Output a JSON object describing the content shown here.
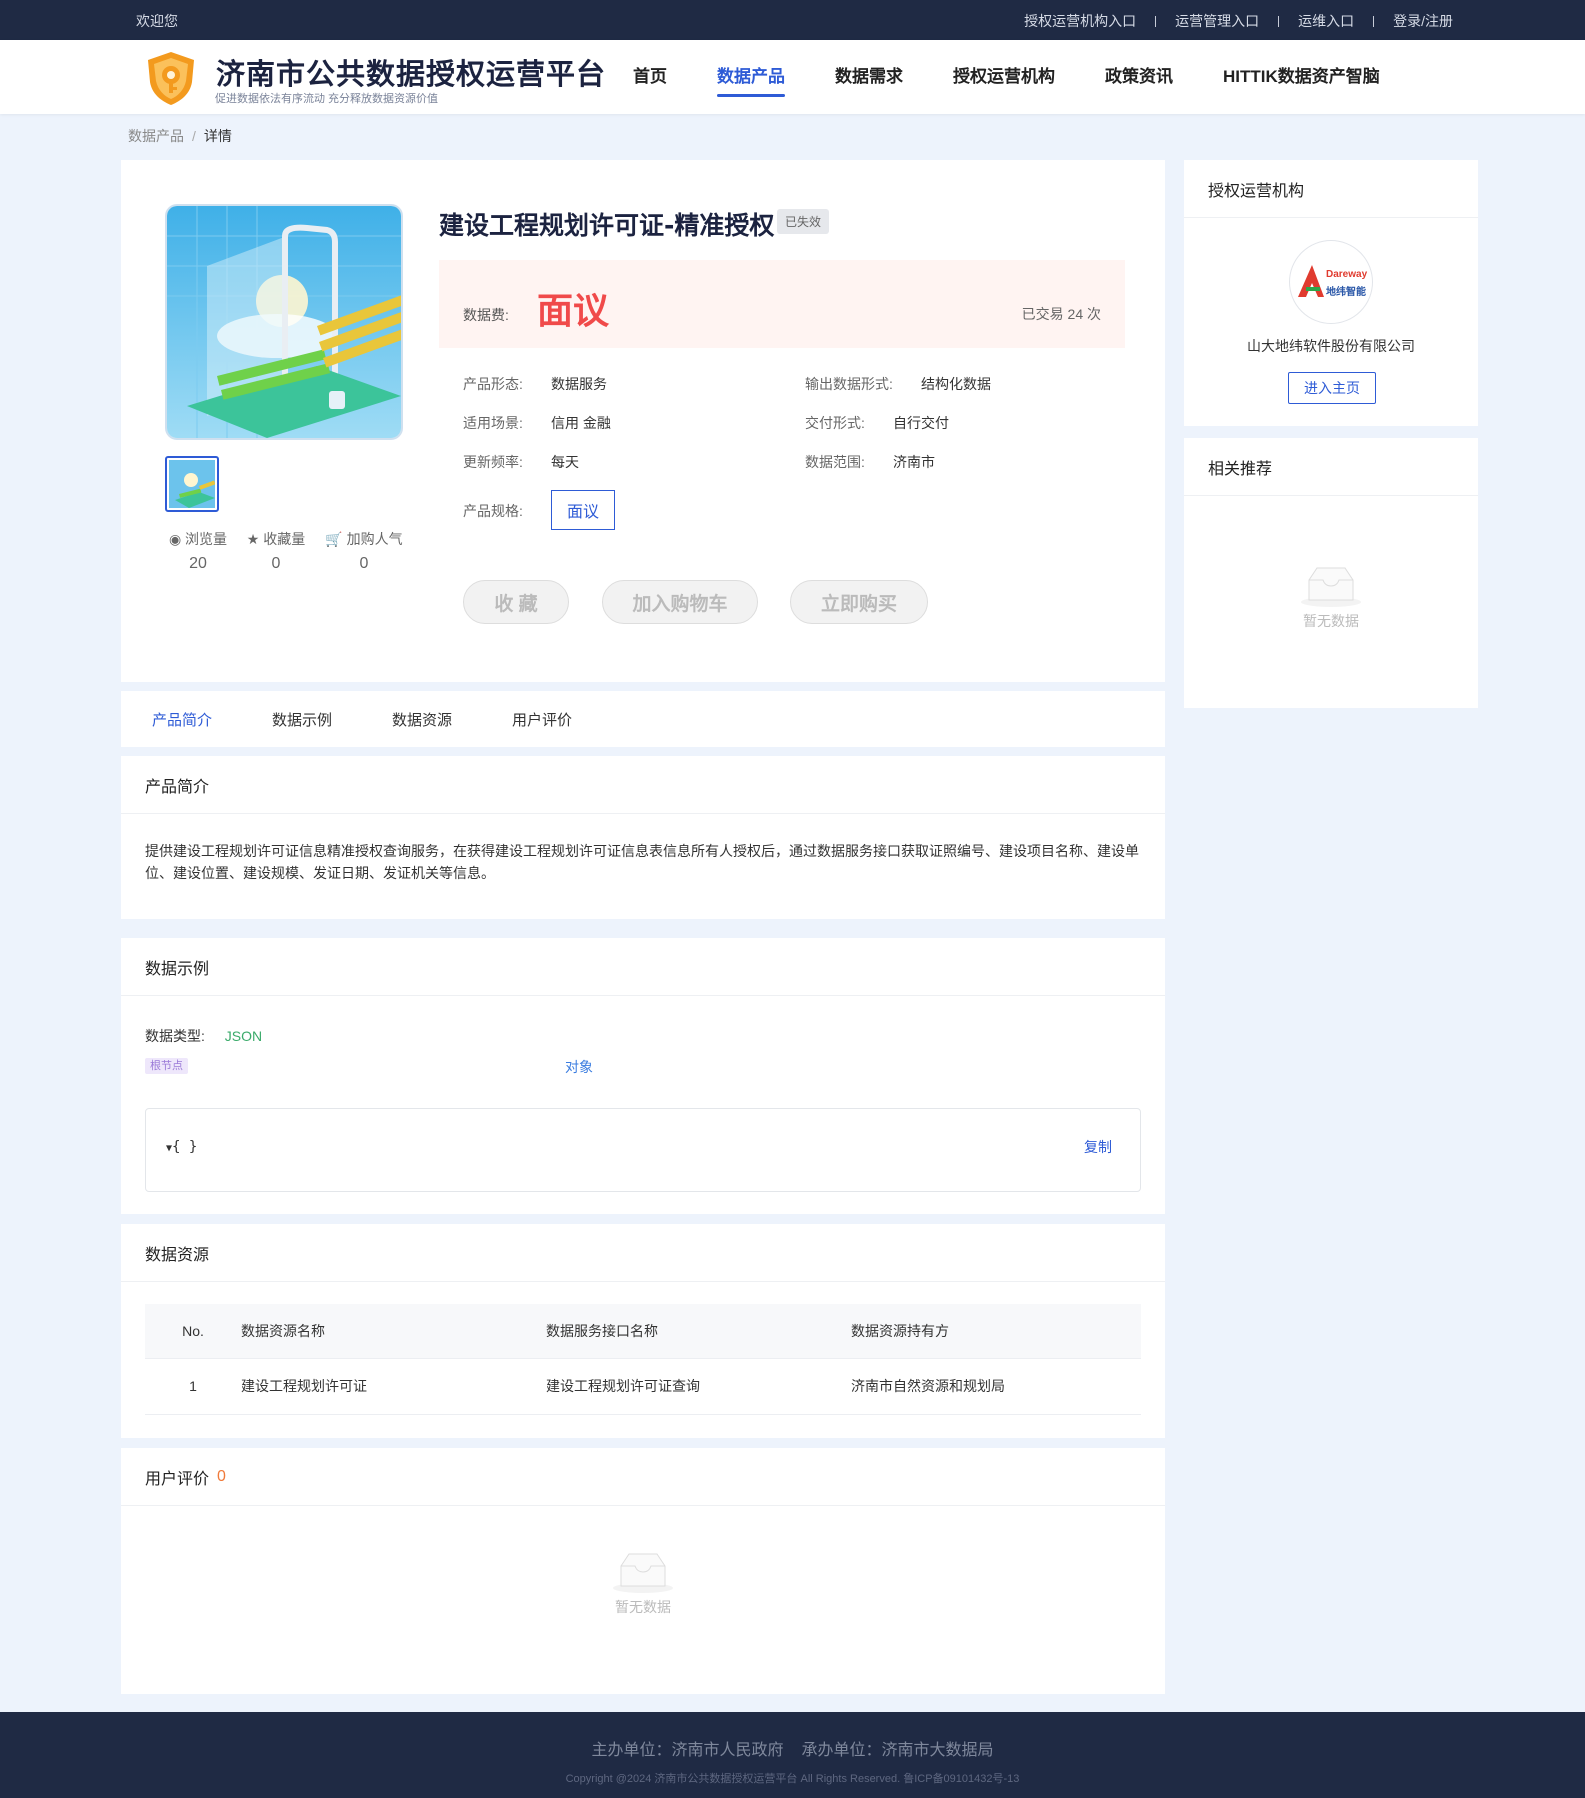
{
  "topbar": {
    "welcome": "欢迎您",
    "links": [
      "授权运营机构入口",
      "运营管理入口",
      "运维入口",
      "登录/注册"
    ]
  },
  "header": {
    "title": "济南市公共数据授权运营平台",
    "subtitle": "促进数据依法有序流动 充分释放数据资源价值",
    "nav": [
      "首页",
      "数据产品",
      "数据需求",
      "授权运营机构",
      "政策资讯",
      "HITTIK数据资产智脑"
    ],
    "active_nav": "数据产品"
  },
  "breadcrumb": {
    "parent": "数据产品",
    "sep": "/",
    "current": "详情"
  },
  "product": {
    "title": "建设工程规划许可证-精准授权",
    "status": "已失效",
    "price_label": "数据费:",
    "price": "面议",
    "traded": "已交易 24 次",
    "attrs": {
      "form_k": "产品形态:",
      "form_v": "数据服务",
      "output_k": "输出数据形式:",
      "output_v": "结构化数据",
      "scene_k": "适用场景:",
      "scene_v": "信用 金融",
      "delivery_k": "交付形式:",
      "delivery_v": "自行交付",
      "freq_k": "更新频率:",
      "freq_v": "每天",
      "range_k": "数据范围:",
      "range_v": "济南市",
      "spec_k": "产品规格:",
      "spec_v": "面议"
    },
    "stats": {
      "views_label": "浏览量",
      "views": "20",
      "fav_label": "收藏量",
      "fav": "0",
      "cart_label": "加购人气",
      "cart": "0"
    },
    "actions": {
      "fav": "收 藏",
      "cart": "加入购物车",
      "buy": "立即购买"
    }
  },
  "tabs": [
    "产品简介",
    "数据示例",
    "数据资源",
    "用户评价"
  ],
  "intro": {
    "title": "产品简介",
    "text": "提供建设工程规划许可证信息精准授权查询服务，在获得建设工程规划许可证信息表信息所有人授权后，通过数据服务接口获取证照编号、建设项目名称、建设单位、建设位置、建设规模、发证日期、发证机关等信息。"
  },
  "example": {
    "title": "数据示例",
    "type_label": "数据类型:",
    "type_value": "JSON",
    "root_tag": "根节点",
    "object_label": "对象",
    "json_text": "{ }",
    "copy": "复制"
  },
  "resources": {
    "title": "数据资源",
    "headers": [
      "No.",
      "数据资源名称",
      "数据服务接口名称",
      "数据资源持有方"
    ],
    "rows": [
      [
        "1",
        "建设工程规划许可证",
        "建设工程规划许可证查询",
        "济南市自然资源和规划局"
      ]
    ]
  },
  "reviews": {
    "title": "用户评价",
    "count": "0",
    "empty": "暂无数据"
  },
  "sidebar": {
    "org_title": "授权运营机构",
    "org_name": "山大地纬软件股份有限公司",
    "org_logo_text1": "Dareway",
    "org_logo_text2": "地纬智能",
    "enter": "进入主页",
    "rec_title": "相关推荐",
    "rec_empty": "暂无数据"
  },
  "footer": {
    "host": "主办单位：济南市人民政府",
    "organizer": "承办单位：济南市大数据局",
    "copyright": "Copyright @2024 济南市公共数据授权运营平台 All Rights Reserved. 鲁ICP备09101432号-13"
  },
  "colors": {
    "accent": "#2e5bd6",
    "price": "#f04a4a",
    "topbar": "#1f2a44",
    "background": "#edf3fc"
  }
}
